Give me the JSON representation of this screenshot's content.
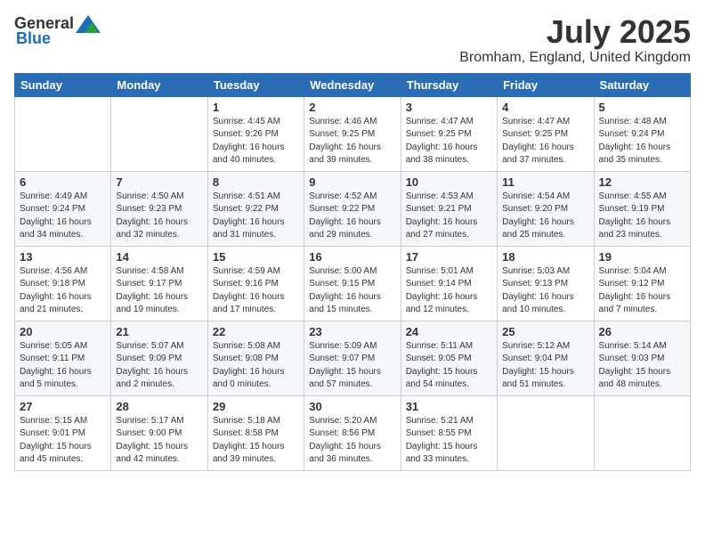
{
  "header": {
    "logo_general": "General",
    "logo_blue": "Blue",
    "month": "July 2025",
    "location": "Bromham, England, United Kingdom"
  },
  "weekdays": [
    "Sunday",
    "Monday",
    "Tuesday",
    "Wednesday",
    "Thursday",
    "Friday",
    "Saturday"
  ],
  "weeks": [
    [
      {
        "day": "",
        "info": ""
      },
      {
        "day": "",
        "info": ""
      },
      {
        "day": "1",
        "info": "Sunrise: 4:45 AM\nSunset: 9:26 PM\nDaylight: 16 hours\nand 40 minutes."
      },
      {
        "day": "2",
        "info": "Sunrise: 4:46 AM\nSunset: 9:25 PM\nDaylight: 16 hours\nand 39 minutes."
      },
      {
        "day": "3",
        "info": "Sunrise: 4:47 AM\nSunset: 9:25 PM\nDaylight: 16 hours\nand 38 minutes."
      },
      {
        "day": "4",
        "info": "Sunrise: 4:47 AM\nSunset: 9:25 PM\nDaylight: 16 hours\nand 37 minutes."
      },
      {
        "day": "5",
        "info": "Sunrise: 4:48 AM\nSunset: 9:24 PM\nDaylight: 16 hours\nand 35 minutes."
      }
    ],
    [
      {
        "day": "6",
        "info": "Sunrise: 4:49 AM\nSunset: 9:24 PM\nDaylight: 16 hours\nand 34 minutes."
      },
      {
        "day": "7",
        "info": "Sunrise: 4:50 AM\nSunset: 9:23 PM\nDaylight: 16 hours\nand 32 minutes."
      },
      {
        "day": "8",
        "info": "Sunrise: 4:51 AM\nSunset: 9:22 PM\nDaylight: 16 hours\nand 31 minutes."
      },
      {
        "day": "9",
        "info": "Sunrise: 4:52 AM\nSunset: 9:22 PM\nDaylight: 16 hours\nand 29 minutes."
      },
      {
        "day": "10",
        "info": "Sunrise: 4:53 AM\nSunset: 9:21 PM\nDaylight: 16 hours\nand 27 minutes."
      },
      {
        "day": "11",
        "info": "Sunrise: 4:54 AM\nSunset: 9:20 PM\nDaylight: 16 hours\nand 25 minutes."
      },
      {
        "day": "12",
        "info": "Sunrise: 4:55 AM\nSunset: 9:19 PM\nDaylight: 16 hours\nand 23 minutes."
      }
    ],
    [
      {
        "day": "13",
        "info": "Sunrise: 4:56 AM\nSunset: 9:18 PM\nDaylight: 16 hours\nand 21 minutes."
      },
      {
        "day": "14",
        "info": "Sunrise: 4:58 AM\nSunset: 9:17 PM\nDaylight: 16 hours\nand 19 minutes."
      },
      {
        "day": "15",
        "info": "Sunrise: 4:59 AM\nSunset: 9:16 PM\nDaylight: 16 hours\nand 17 minutes."
      },
      {
        "day": "16",
        "info": "Sunrise: 5:00 AM\nSunset: 9:15 PM\nDaylight: 16 hours\nand 15 minutes."
      },
      {
        "day": "17",
        "info": "Sunrise: 5:01 AM\nSunset: 9:14 PM\nDaylight: 16 hours\nand 12 minutes."
      },
      {
        "day": "18",
        "info": "Sunrise: 5:03 AM\nSunset: 9:13 PM\nDaylight: 16 hours\nand 10 minutes."
      },
      {
        "day": "19",
        "info": "Sunrise: 5:04 AM\nSunset: 9:12 PM\nDaylight: 16 hours\nand 7 minutes."
      }
    ],
    [
      {
        "day": "20",
        "info": "Sunrise: 5:05 AM\nSunset: 9:11 PM\nDaylight: 16 hours\nand 5 minutes."
      },
      {
        "day": "21",
        "info": "Sunrise: 5:07 AM\nSunset: 9:09 PM\nDaylight: 16 hours\nand 2 minutes."
      },
      {
        "day": "22",
        "info": "Sunrise: 5:08 AM\nSunset: 9:08 PM\nDaylight: 16 hours\nand 0 minutes."
      },
      {
        "day": "23",
        "info": "Sunrise: 5:09 AM\nSunset: 9:07 PM\nDaylight: 15 hours\nand 57 minutes."
      },
      {
        "day": "24",
        "info": "Sunrise: 5:11 AM\nSunset: 9:05 PM\nDaylight: 15 hours\nand 54 minutes."
      },
      {
        "day": "25",
        "info": "Sunrise: 5:12 AM\nSunset: 9:04 PM\nDaylight: 15 hours\nand 51 minutes."
      },
      {
        "day": "26",
        "info": "Sunrise: 5:14 AM\nSunset: 9:03 PM\nDaylight: 15 hours\nand 48 minutes."
      }
    ],
    [
      {
        "day": "27",
        "info": "Sunrise: 5:15 AM\nSunset: 9:01 PM\nDaylight: 15 hours\nand 45 minutes."
      },
      {
        "day": "28",
        "info": "Sunrise: 5:17 AM\nSunset: 9:00 PM\nDaylight: 15 hours\nand 42 minutes."
      },
      {
        "day": "29",
        "info": "Sunrise: 5:18 AM\nSunset: 8:58 PM\nDaylight: 15 hours\nand 39 minutes."
      },
      {
        "day": "30",
        "info": "Sunrise: 5:20 AM\nSunset: 8:56 PM\nDaylight: 15 hours\nand 36 minutes."
      },
      {
        "day": "31",
        "info": "Sunrise: 5:21 AM\nSunset: 8:55 PM\nDaylight: 15 hours\nand 33 minutes."
      },
      {
        "day": "",
        "info": ""
      },
      {
        "day": "",
        "info": ""
      }
    ]
  ]
}
